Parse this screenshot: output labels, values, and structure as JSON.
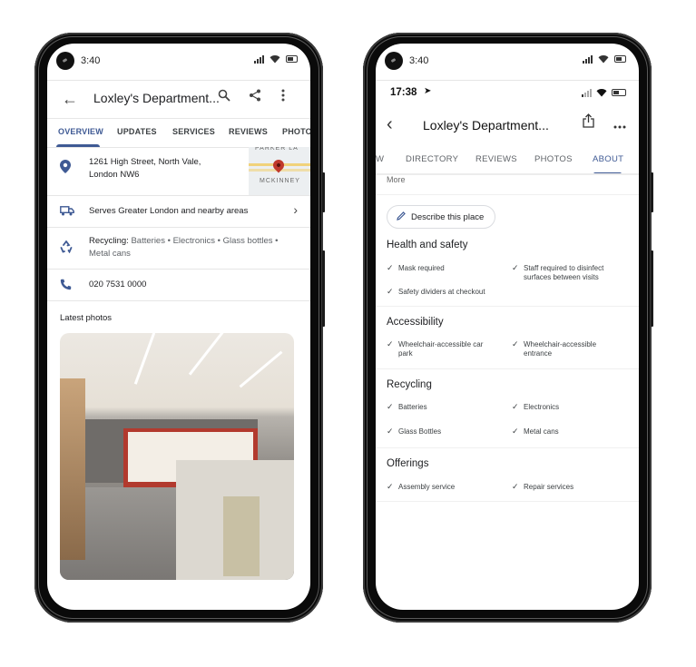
{
  "left_phone": {
    "status_time": "3:40",
    "app_title": "Loxley's Department...",
    "tabs": [
      {
        "label": "OVERVIEW",
        "active": true
      },
      {
        "label": "UPDATES",
        "active": false
      },
      {
        "label": "SERVICES",
        "active": false
      },
      {
        "label": "REVIEWS",
        "active": false
      },
      {
        "label": "PHOTOS",
        "active": false
      }
    ],
    "address_line1": "1261 High Street, North Vale,",
    "address_line2": "London NW6",
    "map_labels": {
      "top": "PARKER LA",
      "bottom": "MCKINNEY"
    },
    "service_area": "Serves Greater London and nearby areas",
    "recycling_label": "Recycling:",
    "recycling_items_line1": "Batteries • Electronics • Glass bottles •",
    "recycling_items_line2": "Metal cans",
    "phone": "020 7531 0000",
    "latest_photos_label": "Latest photos",
    "accent_color": "#3f5a94"
  },
  "right_phone": {
    "status_time": "3:40",
    "ios_time": "17:38",
    "app_title": "Loxley's Department...",
    "tabs": [
      {
        "label": "W",
        "active": false
      },
      {
        "label": "DIRECTORY",
        "active": false
      },
      {
        "label": "REVIEWS",
        "active": false
      },
      {
        "label": "PHOTOS",
        "active": false
      },
      {
        "label": "ABOUT",
        "active": true
      }
    ],
    "more_label": "More",
    "describe_button": "Describe this place",
    "sections": [
      {
        "title": "Health and safety",
        "items": [
          "Mask required",
          "Staff required to disinfect surfaces between visits",
          "Safety dividers at checkout"
        ]
      },
      {
        "title": "Accessibility",
        "items": [
          "Wheelchair-accessible car park",
          "Wheelchair-accessible entrance"
        ]
      },
      {
        "title": "Recycling",
        "items": [
          "Batteries",
          "Electronics",
          "Glass Bottles",
          "Metal cans"
        ]
      },
      {
        "title": "Offerings",
        "items": [
          "Assembly service",
          "Repair services"
        ]
      }
    ]
  }
}
